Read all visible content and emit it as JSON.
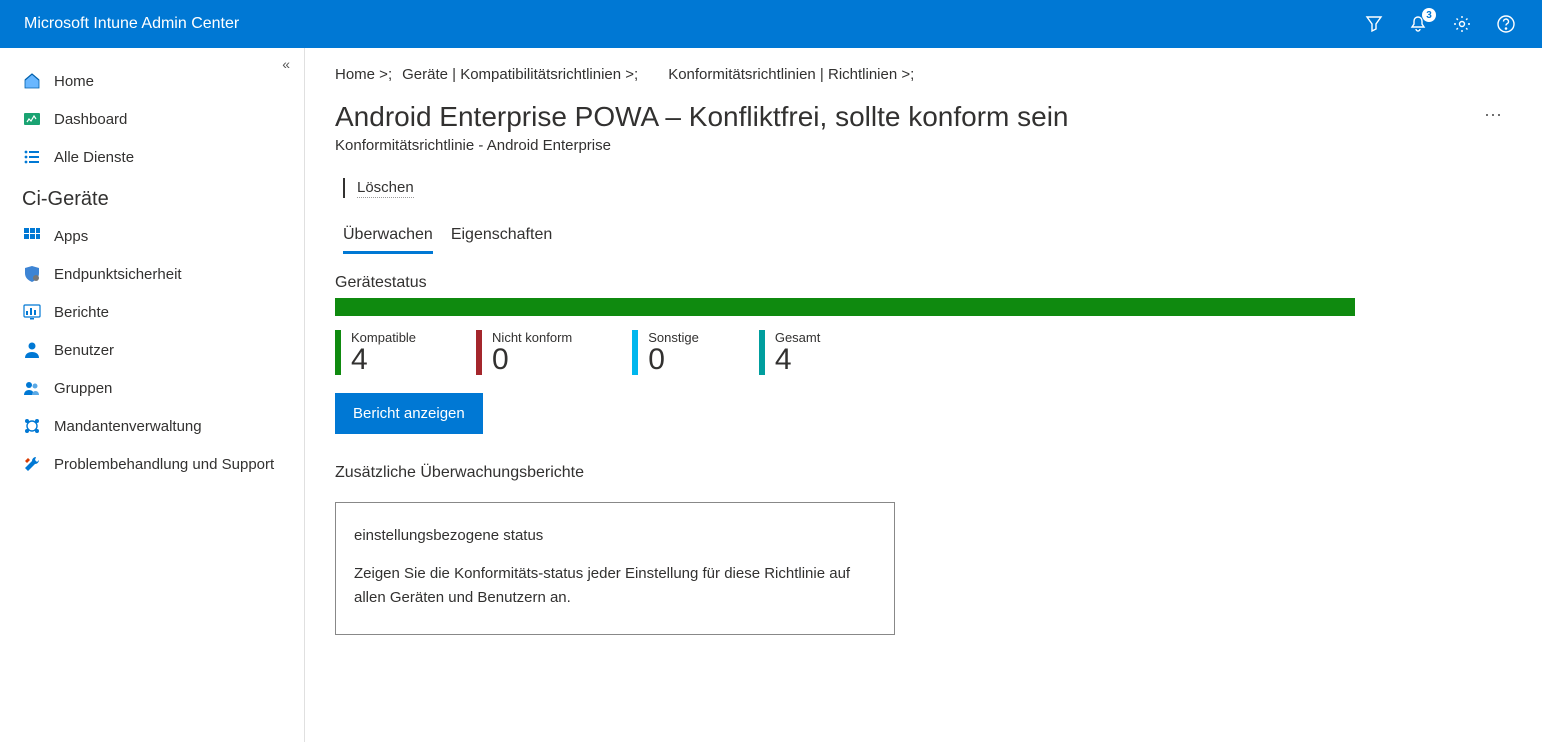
{
  "header": {
    "title": "Microsoft Intune Admin Center",
    "notification_count": "3"
  },
  "sidebar": {
    "items_top": [
      {
        "label": "Home",
        "icon": "home"
      },
      {
        "label": "Dashboard",
        "icon": "dashboard"
      },
      {
        "label": "Alle Dienste",
        "icon": "list"
      }
    ],
    "group_heading": "Ci-Geräte",
    "items_bottom": [
      {
        "label": "Apps",
        "icon": "apps"
      },
      {
        "label": "Endpunktsicherheit",
        "icon": "shield"
      },
      {
        "label": "Berichte",
        "icon": "reports"
      },
      {
        "label": "Benutzer",
        "icon": "user"
      },
      {
        "label": "Gruppen",
        "icon": "group"
      },
      {
        "label": "Mandantenverwaltung",
        "icon": "tenant"
      },
      {
        "label": "Problembehandlung und Support",
        "icon": "wrench"
      }
    ]
  },
  "breadcrumbs": [
    "Home >;",
    "Geräte | Kompatibilitätsrichtlinien >;",
    "Konformitätsrichtlinien | Richtlinien >;"
  ],
  "page": {
    "title": "Android Enterprise POWA – Konfliktfrei, sollte konform sein",
    "subtitle": "Konformitätsrichtlinie - Android Enterprise"
  },
  "toolbar": {
    "delete": "Löschen"
  },
  "tabs": {
    "monitor": "Überwachen",
    "properties": "Eigenschaften"
  },
  "device_status": {
    "heading": "Gerätestatus",
    "stats": [
      {
        "label": "Kompatible",
        "value": "4",
        "color": "#0f8a0f"
      },
      {
        "label": "Nicht konform",
        "value": "0",
        "color": "#a4262c"
      },
      {
        "label": "Sonstige",
        "value": "0",
        "color": "#00b7ee"
      },
      {
        "label": "Gesamt",
        "value": "4",
        "color": "#009e9e"
      }
    ],
    "report_button": "Bericht anzeigen"
  },
  "additional": {
    "heading": "Zusätzliche Überwachungsberichte",
    "card": {
      "title": "einstellungsbezogene status",
      "body": "Zeigen Sie die Konformitäts-status jeder Einstellung für diese Richtlinie auf allen Geräten und Benutzern an."
    }
  },
  "colors": {
    "primary": "#0078d4",
    "green": "#0f8a0f"
  }
}
